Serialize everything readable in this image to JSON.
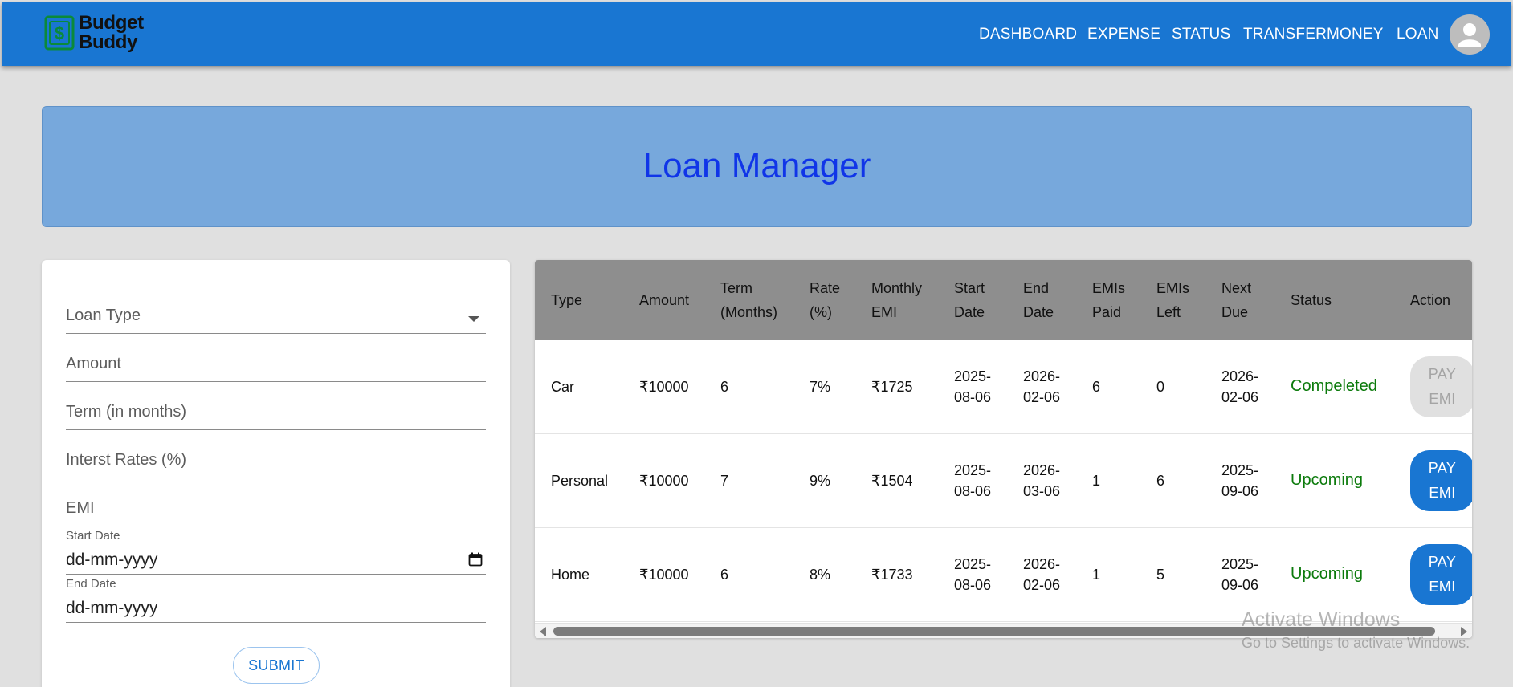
{
  "app": {
    "brand_line1": "Budget",
    "brand_line2": "Buddy",
    "logo_icon": "dollar-wallet-icon",
    "accent_color": "#1976d2"
  },
  "nav": {
    "items": [
      {
        "label": "DASHBOARD"
      },
      {
        "label": "EXPENSE"
      },
      {
        "label": "STATUS"
      },
      {
        "label": "TRANSFERMONEY"
      },
      {
        "label": "LOAN"
      }
    ],
    "avatar_icon": "user-avatar-icon"
  },
  "hero": {
    "title": "Loan Manager"
  },
  "form": {
    "loan_type_label": "Loan Type",
    "amount_label": "Amount",
    "term_label": "Term (in months)",
    "rate_label": "Interst Rates (%)",
    "emi_label": "EMI",
    "start_date_label": "Start Date",
    "start_date_value": "dd-mm-yyyy",
    "end_date_label": "End Date",
    "end_date_value": "dd-mm-yyyy",
    "submit_label": "SUBMIT"
  },
  "table": {
    "headers": {
      "type": "Type",
      "amount": "Amount",
      "term_1": "Term",
      "term_2": "(Months)",
      "rate_1": "Rate",
      "rate_2": "(%)",
      "emi_1": "Monthly",
      "emi_2": "EMI",
      "start_1": "Start",
      "start_2": "Date",
      "end_1": "End",
      "end_2": "Date",
      "paid_1": "EMIs",
      "paid_2": "Paid",
      "left_1": "EMIs",
      "left_2": "Left",
      "next_1": "Next",
      "next_2": "Due",
      "status": "Status",
      "action": "Action"
    },
    "rows": [
      {
        "type": "Car",
        "amount": "₹10000",
        "term": "6",
        "rate": "7%",
        "emi": "₹1725",
        "start_1": "2025-",
        "start_2": "08-06",
        "end_1": "2026-",
        "end_2": "02-06",
        "paid": "6",
        "left": "0",
        "next_1": "2026-",
        "next_2": "02-06",
        "status": "Compeleted",
        "action_1": "PAY",
        "action_2": "EMI",
        "action_enabled": false
      },
      {
        "type": "Personal",
        "amount": "₹10000",
        "term": "7",
        "rate": "9%",
        "emi": "₹1504",
        "start_1": "2025-",
        "start_2": "08-06",
        "end_1": "2026-",
        "end_2": "03-06",
        "paid": "1",
        "left": "6",
        "next_1": "2025-",
        "next_2": "09-06",
        "status": "Upcoming",
        "action_1": "PAY",
        "action_2": "EMI",
        "action_enabled": true
      },
      {
        "type": "Home",
        "amount": "₹10000",
        "term": "6",
        "rate": "8%",
        "emi": "₹1733",
        "start_1": "2025-",
        "start_2": "08-06",
        "end_1": "2026-",
        "end_2": "02-06",
        "paid": "1",
        "left": "5",
        "next_1": "2025-",
        "next_2": "09-06",
        "status": "Upcoming",
        "action_1": "PAY",
        "action_2": "EMI",
        "action_enabled": true
      }
    ]
  },
  "watermark": {
    "title": "Activate Windows",
    "subtitle": "Go to Settings to activate Windows."
  }
}
